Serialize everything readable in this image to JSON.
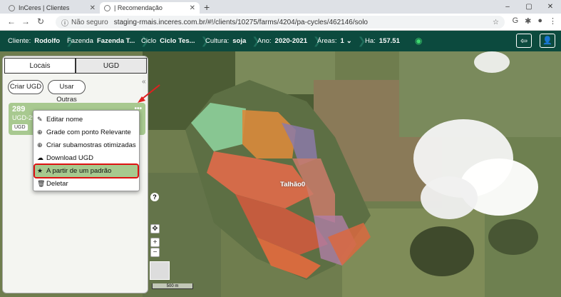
{
  "browser": {
    "tabs": [
      {
        "title": "InCeres | Clientes",
        "active": false
      },
      {
        "title": "| Recomendação",
        "active": true
      }
    ],
    "new_tab": "+",
    "window_controls": [
      "–",
      "▢",
      "✕"
    ],
    "insecure_label": "Não seguro",
    "url": "staging-rmais.inceres.com.br/#!/clients/10275/farms/4204/pa-cycles/462146/solo"
  },
  "header": {
    "cliente_label": "Cliente:",
    "cliente_value": "Rodolfo",
    "fazenda_label": "Fazenda",
    "fazenda_value": "Fazenda T...",
    "ciclo_label": "Ciclo",
    "ciclo_value": "Ciclo Tes...",
    "cultura_label": "Cultura:",
    "cultura_value": "soja",
    "ano_label": "Ano:",
    "ano_value": "2020-2021",
    "areas_label": "Áreas:",
    "areas_value": "1",
    "ha_label": "Ha:",
    "ha_value": "157.51"
  },
  "panel": {
    "tabs": [
      "Locais",
      "UGD"
    ],
    "active_tab": "UGD",
    "criar_button": "Criar UGD",
    "usar_button": "Usar Outras",
    "card": {
      "id": "289",
      "name": "UGD-29...",
      "badge": "UGD",
      "dots": "•••"
    }
  },
  "context_menu": {
    "items": [
      {
        "icon": "pencil-icon",
        "label": "Editar nome"
      },
      {
        "icon": "plus-circle-icon",
        "label": "Grade com ponto Relevante"
      },
      {
        "icon": "plus-circle-icon",
        "label": "Criar subamostras otimizadas"
      },
      {
        "icon": "cloud-download-icon",
        "label": "Download UGD"
      },
      {
        "icon": "star-icon",
        "label": "A partir de um padrão",
        "highlighted": true
      },
      {
        "icon": "trash-icon",
        "label": "Deletar"
      }
    ]
  },
  "map": {
    "field_label": "Talhão0",
    "scale_label": "500 m",
    "zoom_in": "+",
    "zoom_out": "−",
    "help": "?"
  },
  "colors": {
    "header_bg": "#0c4a3e",
    "highlight": "#a7c98e",
    "highlight_border": "#d11111",
    "card_bg": "#a8c990"
  }
}
